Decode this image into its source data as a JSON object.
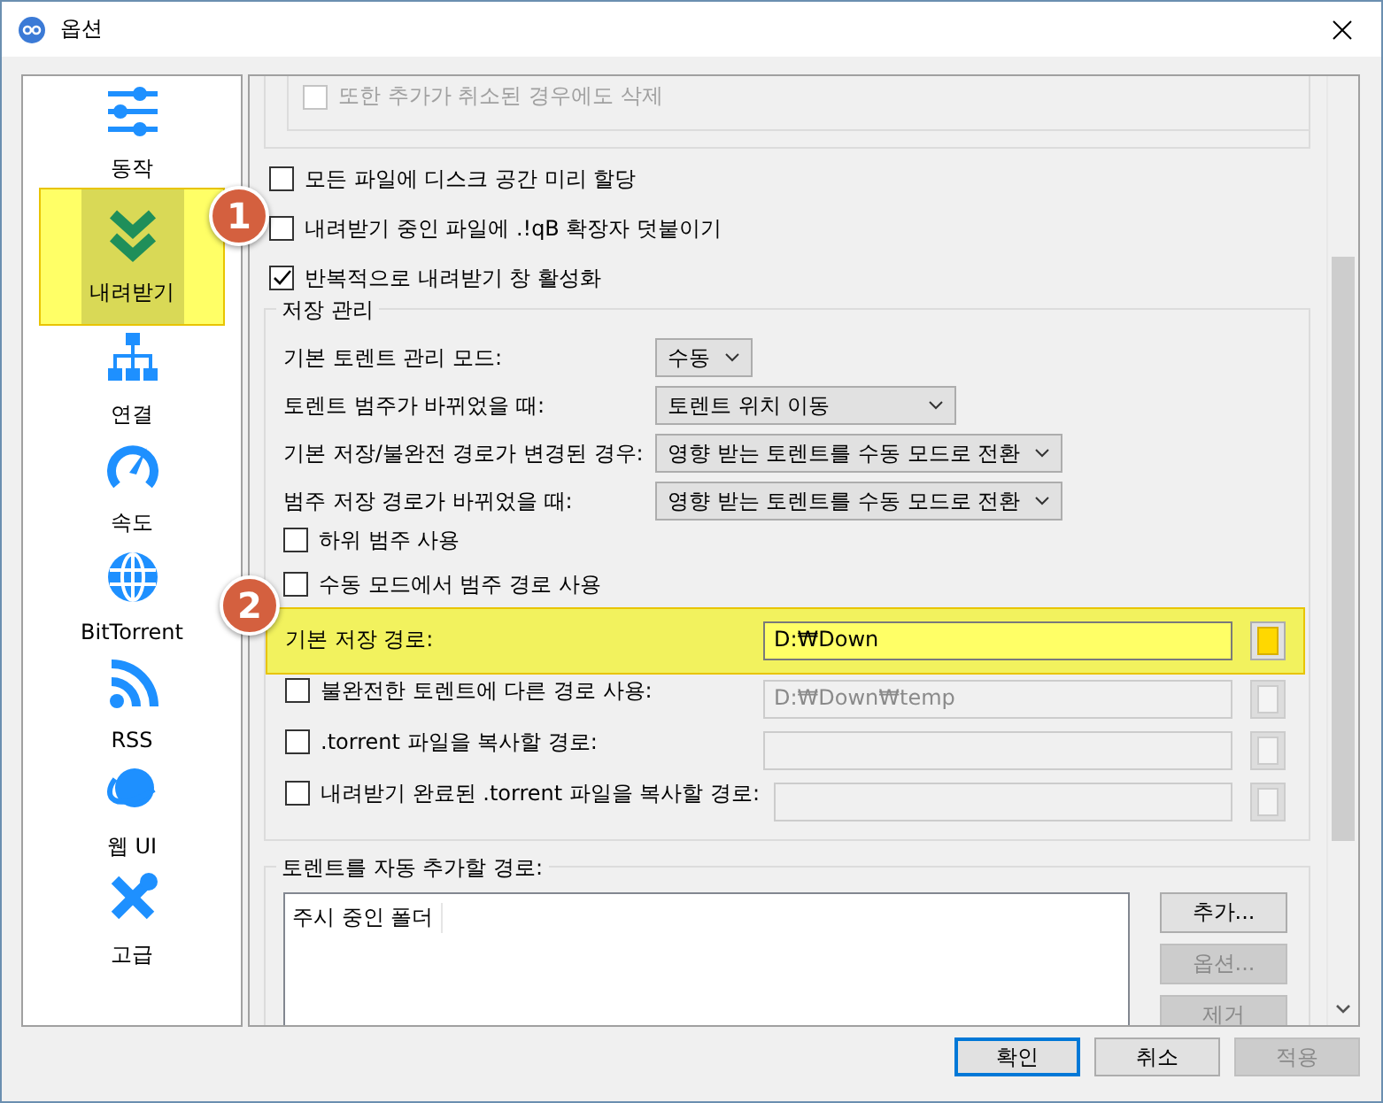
{
  "window": {
    "title": "옵션"
  },
  "sidebar": {
    "items": [
      {
        "label": "동작",
        "selected": false
      },
      {
        "label": "내려받기",
        "selected": true
      },
      {
        "label": "연결",
        "selected": false
      },
      {
        "label": "속도",
        "selected": false
      },
      {
        "label": "BitTorrent",
        "selected": false
      },
      {
        "label": "RSS",
        "selected": false
      },
      {
        "label": "웹 UI",
        "selected": false
      },
      {
        "label": "고급",
        "selected": false
      }
    ]
  },
  "top_group": {
    "checkbox": {
      "label": "또한 추가가 취소된 경우에도 삭제",
      "checked": false,
      "disabled": true
    }
  },
  "checkboxes": [
    {
      "label": "모든 파일에 디스크 공간 미리 할당",
      "checked": false
    },
    {
      "label": "내려받기 중인 파일에 .!qB 확장자 덧붙이기",
      "checked": false
    },
    {
      "label": "반복적으로 내려받기 창 활성화",
      "checked": true
    }
  ],
  "storage_group": {
    "title": "저장 관리",
    "combos": [
      {
        "label": "기본 토렌트 관리 모드:",
        "value": "수동"
      },
      {
        "label": "토렌트 범주가 바뀌었을 때:",
        "value": "토렌트 위치 이동"
      },
      {
        "label": "기본 저장/불완전 경로가 변경된 경우:",
        "value": "영향 받는 토렌트를 수동 모드로 전환"
      },
      {
        "label": "범주 저장 경로가 바뀌었을 때:",
        "value": "영향 받는 토렌트를 수동 모드로 전환"
      }
    ],
    "checkboxes": [
      {
        "label": "하위 범주 사용",
        "checked": false
      },
      {
        "label": "수동 모드에서 범주 경로 사용",
        "checked": false
      }
    ],
    "paths": [
      {
        "kind": "label",
        "label": "기본 저장 경로:",
        "value": "D:₩Down",
        "disabled": false
      },
      {
        "kind": "checkbox",
        "label": "불완전한 토렌트에 다른 경로 사용:",
        "checked": false,
        "value": "D:₩Down₩temp",
        "disabled": true
      },
      {
        "kind": "checkbox",
        "label": ".torrent 파일을 복사할 경로:",
        "checked": false,
        "disabled": true
      },
      {
        "kind": "checkbox",
        "label": "내려받기 완료된 .torrent 파일을 복사할 경로:",
        "checked": false,
        "disabled": true
      }
    ]
  },
  "watch_group": {
    "title": "토렌트를 자동 추가할 경로:",
    "column": "주시 중인 폴더",
    "buttons": [
      {
        "label": "추가...",
        "disabled": false
      },
      {
        "label": "옵션...",
        "disabled": true
      },
      {
        "label": "제거",
        "disabled": true
      }
    ]
  },
  "buttons": [
    {
      "label": "확인",
      "disabled": false,
      "default": true
    },
    {
      "label": "취소",
      "disabled": false,
      "default": false
    },
    {
      "label": "적용",
      "disabled": true,
      "default": false
    }
  ],
  "annotations": [
    {
      "number": "1"
    },
    {
      "number": "2"
    }
  ]
}
